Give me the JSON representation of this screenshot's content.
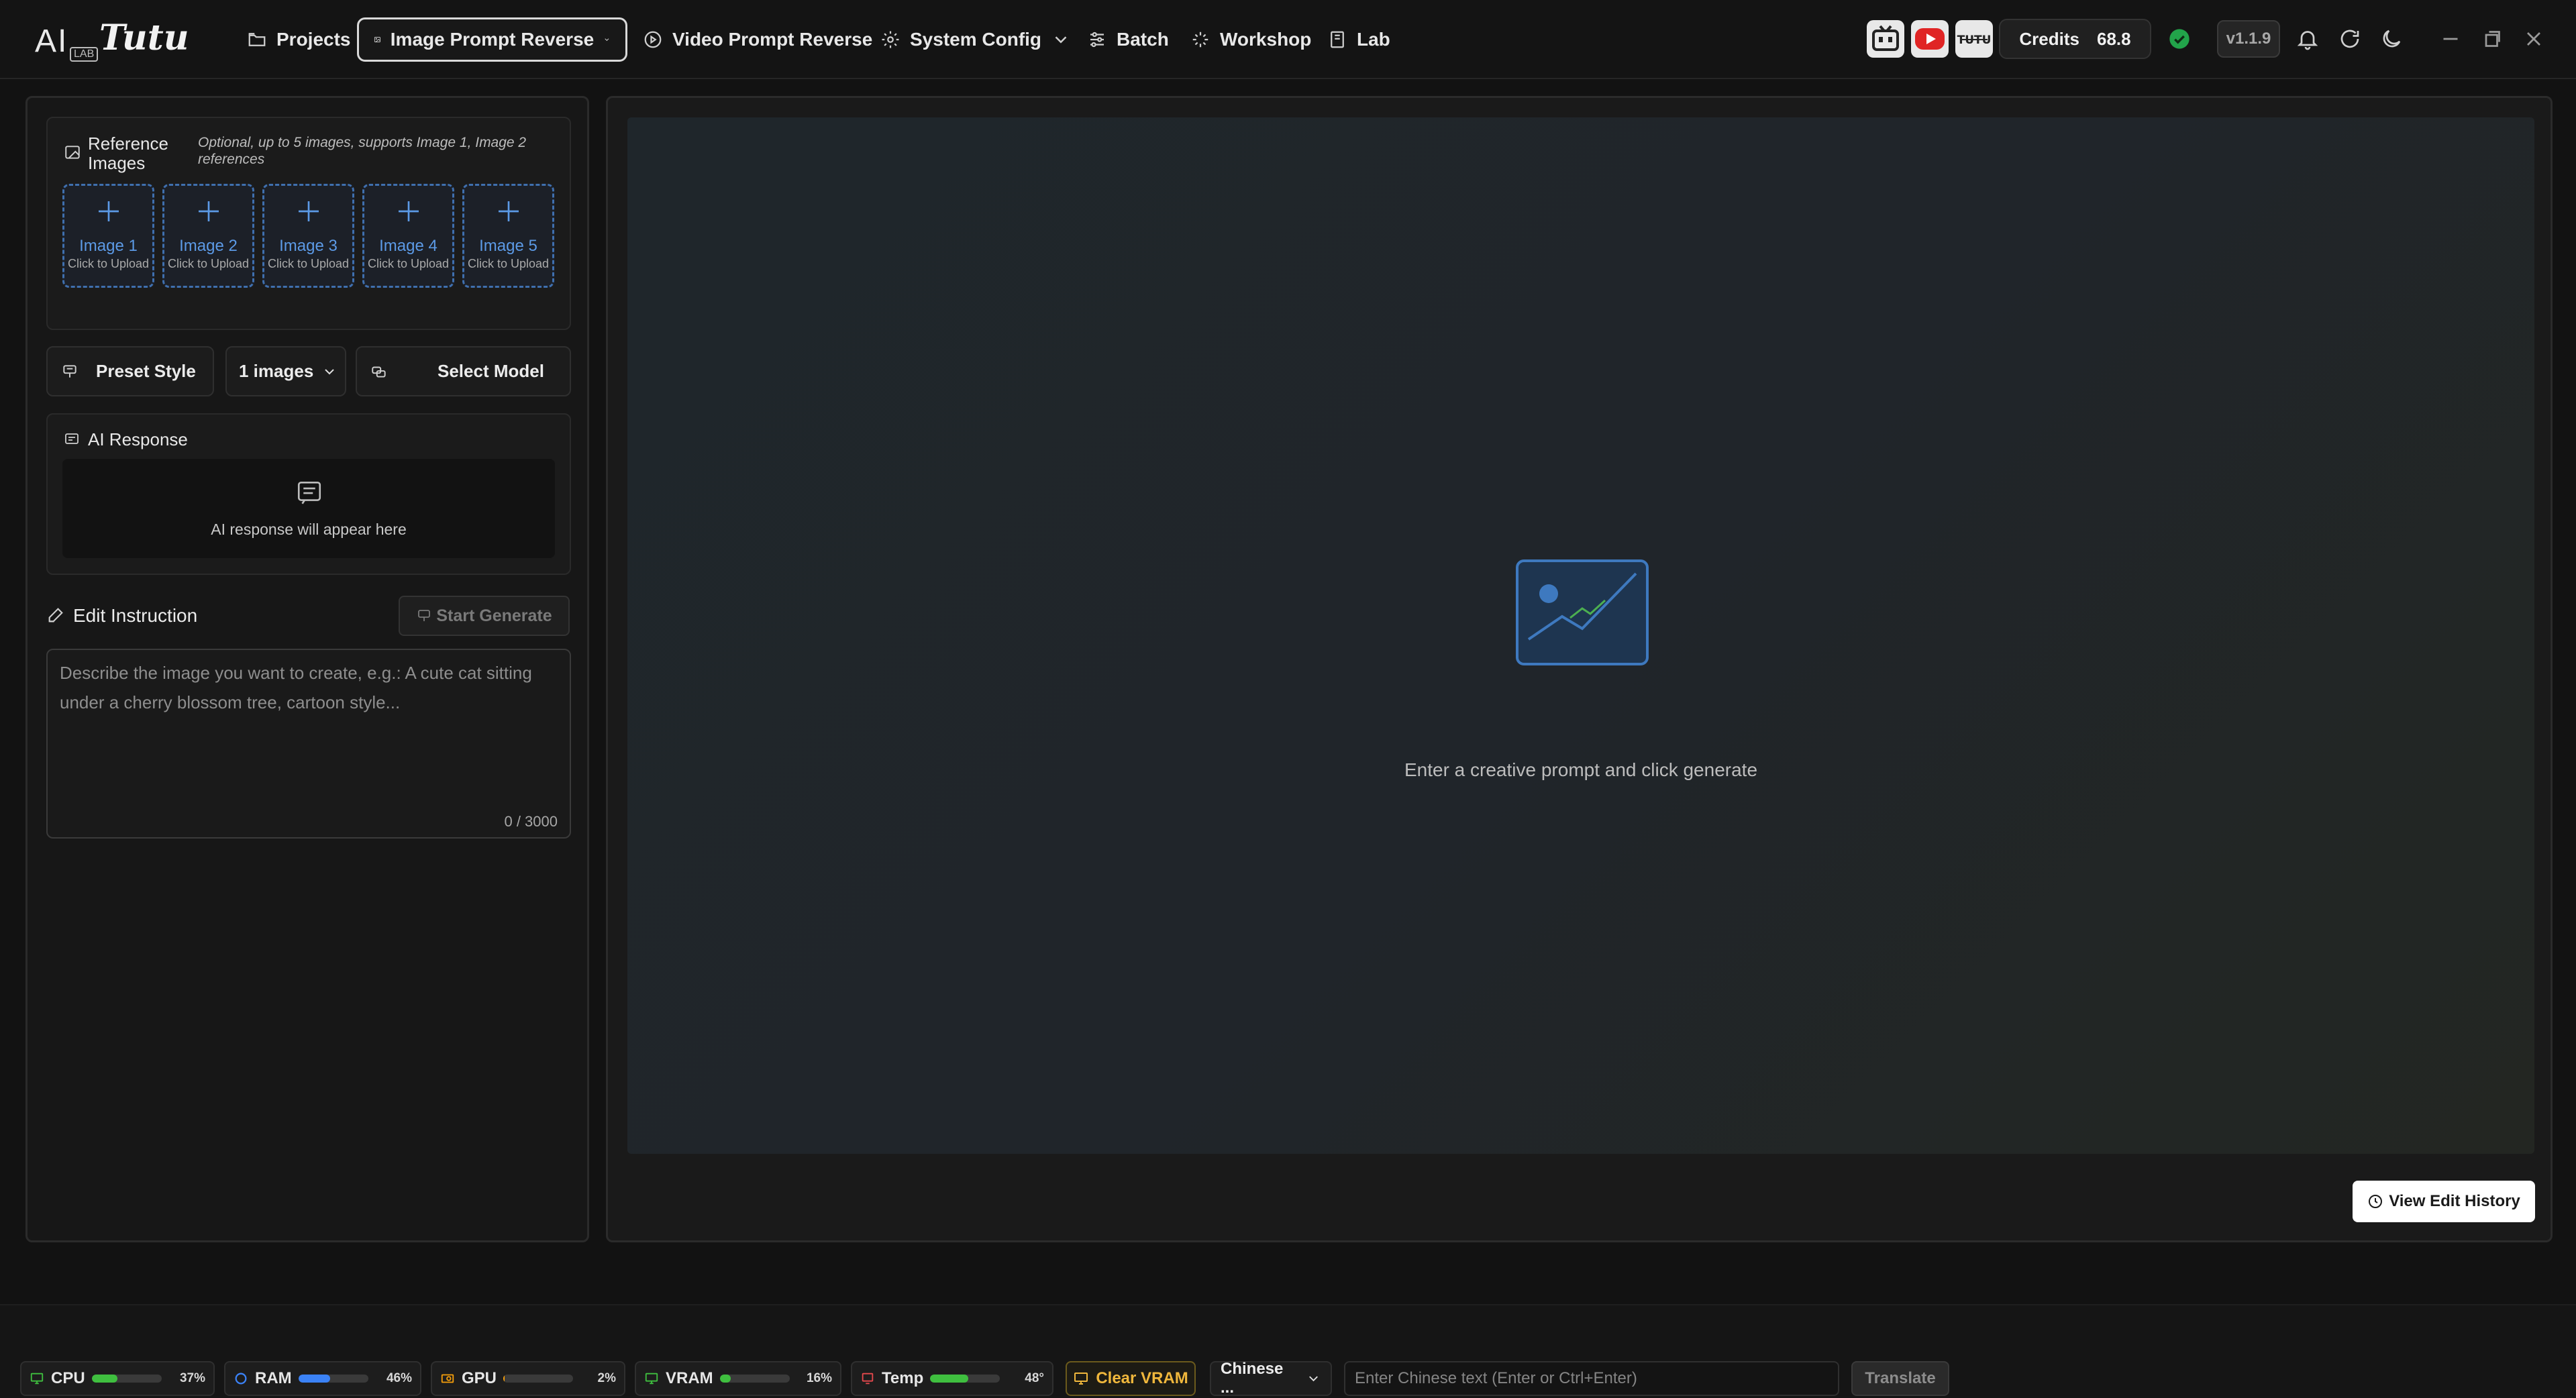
{
  "app": {
    "logo": {
      "ai": "AI",
      "lab": "LAB",
      "name": "Tutu"
    }
  },
  "nav": {
    "projects": "Projects",
    "image_prompt_reverse": "Image Prompt Reverse",
    "video_prompt_reverse": "Video Prompt Reverse",
    "system_config": "System Config",
    "batch": "Batch",
    "workshop": "Workshop",
    "lab": "Lab"
  },
  "header": {
    "brand_icons": [
      "bilibili-icon",
      "youtube-icon",
      "tutu-icon"
    ],
    "credits_label": "Credits",
    "credits_value": "68.8",
    "status_color": "#22a34a",
    "version": "v1.1.9"
  },
  "left": {
    "reference": {
      "title": "Reference Images",
      "hint": "Optional, up to 5 images, supports Image 1, Image 2 references",
      "slots": [
        {
          "label": "Image 1",
          "sub": "Click to Upload"
        },
        {
          "label": "Image 2",
          "sub": "Click to Upload"
        },
        {
          "label": "Image 3",
          "sub": "Click to Upload"
        },
        {
          "label": "Image 4",
          "sub": "Click to Upload"
        },
        {
          "label": "Image 5",
          "sub": "Click to Upload"
        }
      ]
    },
    "controls": {
      "preset_style": "Preset Style",
      "image_count": "1 images",
      "select_model": "Select Model"
    },
    "ai_response": {
      "title": "AI Response",
      "empty": "AI response will appear here"
    },
    "edit": {
      "title": "Edit Instruction",
      "start": "Start Generate",
      "placeholder": "Describe the image you want to create, e.g.: A cute cat sitting under a cherry blossom tree, cartoon style...",
      "value": "",
      "counter": "0 / 3000"
    }
  },
  "right": {
    "placeholder": "Enter a creative prompt and click generate",
    "history_button": "View Edit History"
  },
  "status": {
    "cpu": {
      "label": "CPU",
      "pct": "37%",
      "fill": 0.37,
      "color": "#3fbf3f"
    },
    "ram": {
      "label": "RAM",
      "pct": "46%",
      "fill": 0.46,
      "color": "#3b82f6"
    },
    "gpu": {
      "label": "GPU",
      "pct": "2%",
      "fill": 0.02,
      "color": "#f59e0b"
    },
    "vram": {
      "label": "VRAM",
      "pct": "16%",
      "fill": 0.16,
      "color": "#3fbf3f"
    },
    "temp": {
      "label": "Temp",
      "pct": "48°",
      "fill": 0.55,
      "color": "#3fbf3f"
    },
    "clear_vram": "Clear VRAM",
    "language": "Chinese ...",
    "translate_placeholder": "Enter Chinese text (Enter or Ctrl+Enter)",
    "translate_value": "",
    "translate_button": "Translate"
  }
}
